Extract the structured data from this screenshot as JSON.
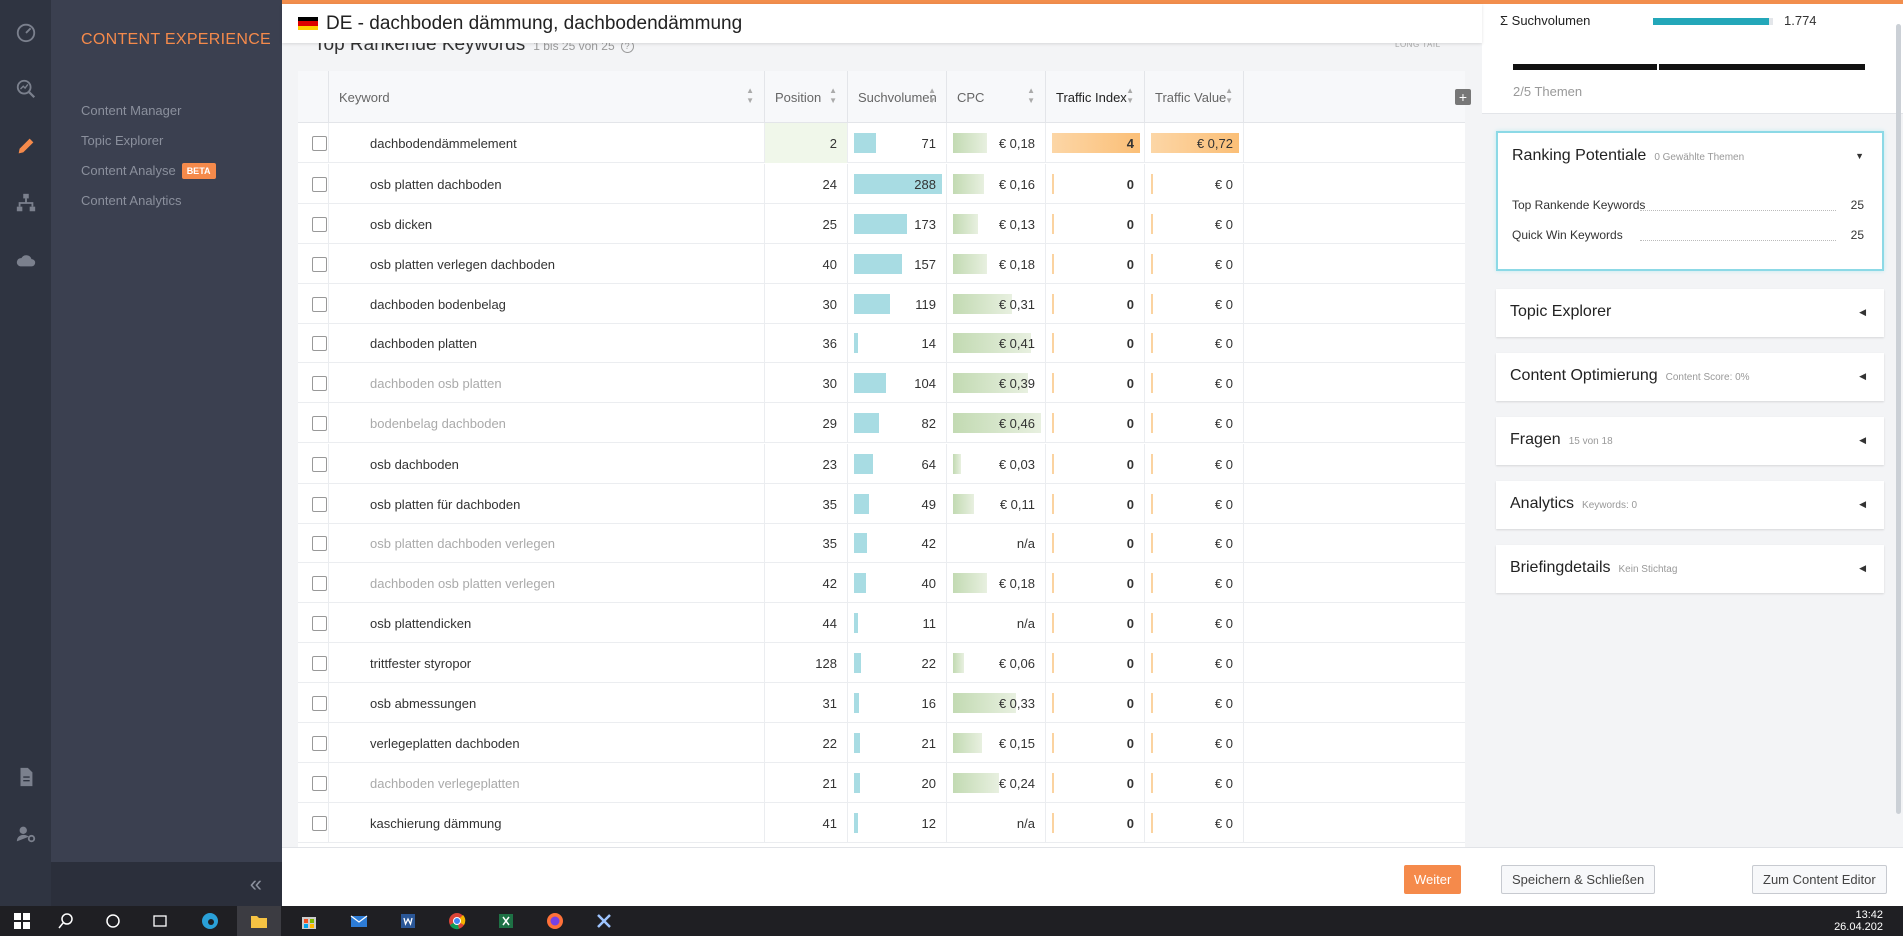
{
  "sidebar": {
    "brand": "CONTENT EXPERIENCE",
    "items": [
      {
        "label": "Content Manager"
      },
      {
        "label": "Topic Explorer"
      },
      {
        "label": "Content Analyse",
        "badge": "BETA"
      },
      {
        "label": "Content Analytics"
      }
    ],
    "collapse_icon": "«"
  },
  "header": {
    "flag": "de-flag-icon",
    "title": "DE - dachboden dämmung, dachbodendämmung"
  },
  "section": {
    "title": "Top Rankende Keywords",
    "count": "1 bis 25 von 25",
    "help": "?",
    "longtail": "LONG TAIL"
  },
  "table": {
    "columns": [
      {
        "label": "Keyword"
      },
      {
        "label": "Position"
      },
      {
        "label": "Suchvolumen"
      },
      {
        "label": "CPC"
      },
      {
        "label": "Traffic Index"
      },
      {
        "label": "Traffic Value"
      }
    ],
    "add_column": "+",
    "rows": [
      {
        "keyword": "dachbodendämmelement",
        "position": "2",
        "volume": "71",
        "volume_share": 0.25,
        "cpc": "€ 0,18",
        "cpc_share": 0.39,
        "ti": "4",
        "tv": "€ 0,72",
        "dim": false,
        "highlight": true
      },
      {
        "keyword": "osb platten dachboden",
        "position": "24",
        "volume": "288",
        "volume_share": 1.0,
        "cpc": "€ 0,16",
        "cpc_share": 0.35,
        "ti": "0",
        "tv": "€ 0",
        "dim": false,
        "highlight": false
      },
      {
        "keyword": "osb dicken",
        "position": "25",
        "volume": "173",
        "volume_share": 0.6,
        "cpc": "€ 0,13",
        "cpc_share": 0.28,
        "ti": "0",
        "tv": "€ 0",
        "dim": false,
        "highlight": false
      },
      {
        "keyword": "osb platten verlegen dachboden",
        "position": "40",
        "volume": "157",
        "volume_share": 0.55,
        "cpc": "€ 0,18",
        "cpc_share": 0.39,
        "ti": "0",
        "tv": "€ 0",
        "dim": false,
        "highlight": false
      },
      {
        "keyword": "dachboden bodenbelag",
        "position": "30",
        "volume": "119",
        "volume_share": 0.41,
        "cpc": "€ 0,31",
        "cpc_share": 0.67,
        "ti": "0",
        "tv": "€ 0",
        "dim": false,
        "highlight": false
      },
      {
        "keyword": "dachboden platten",
        "position": "36",
        "volume": "14",
        "volume_share": 0.05,
        "cpc": "€ 0,41",
        "cpc_share": 0.89,
        "ti": "0",
        "tv": "€ 0",
        "dim": false,
        "highlight": false
      },
      {
        "keyword": "dachboden osb platten",
        "position": "30",
        "volume": "104",
        "volume_share": 0.36,
        "cpc": "€ 0,39",
        "cpc_share": 0.85,
        "ti": "0",
        "tv": "€ 0",
        "dim": true,
        "highlight": false
      },
      {
        "keyword": "bodenbelag dachboden",
        "position": "29",
        "volume": "82",
        "volume_share": 0.28,
        "cpc": "€ 0,46",
        "cpc_share": 1.0,
        "ti": "0",
        "tv": "€ 0",
        "dim": true,
        "highlight": false
      },
      {
        "keyword": "osb dachboden",
        "position": "23",
        "volume": "64",
        "volume_share": 0.22,
        "cpc": "€ 0,03",
        "cpc_share": 0.07,
        "ti": "0",
        "tv": "€ 0",
        "dim": false,
        "highlight": false
      },
      {
        "keyword": "osb platten für dachboden",
        "position": "35",
        "volume": "49",
        "volume_share": 0.17,
        "cpc": "€ 0,11",
        "cpc_share": 0.24,
        "ti": "0",
        "tv": "€ 0",
        "dim": false,
        "highlight": false
      },
      {
        "keyword": "osb platten dachboden verlegen",
        "position": "35",
        "volume": "42",
        "volume_share": 0.15,
        "cpc": "n/a",
        "cpc_share": 0,
        "ti": "0",
        "tv": "€ 0",
        "dim": true,
        "highlight": false
      },
      {
        "keyword": "dachboden osb platten verlegen",
        "position": "42",
        "volume": "40",
        "volume_share": 0.14,
        "cpc": "€ 0,18",
        "cpc_share": 0.39,
        "ti": "0",
        "tv": "€ 0",
        "dim": true,
        "highlight": false
      },
      {
        "keyword": "osb plattendicken",
        "position": "44",
        "volume": "11",
        "volume_share": 0.04,
        "cpc": "n/a",
        "cpc_share": 0,
        "ti": "0",
        "tv": "€ 0",
        "dim": false,
        "highlight": false
      },
      {
        "keyword": "trittfester styropor",
        "position": "128",
        "volume": "22",
        "volume_share": 0.08,
        "cpc": "€ 0,06",
        "cpc_share": 0.13,
        "ti": "0",
        "tv": "€ 0",
        "dim": false,
        "highlight": false
      },
      {
        "keyword": "osb abmessungen",
        "position": "31",
        "volume": "16",
        "volume_share": 0.06,
        "cpc": "€ 0,33",
        "cpc_share": 0.72,
        "ti": "0",
        "tv": "€ 0",
        "dim": false,
        "highlight": false
      },
      {
        "keyword": "verlegeplatten dachboden",
        "position": "22",
        "volume": "21",
        "volume_share": 0.07,
        "cpc": "€ 0,15",
        "cpc_share": 0.33,
        "ti": "0",
        "tv": "€ 0",
        "dim": false,
        "highlight": false
      },
      {
        "keyword": "dachboden verlegeplatten",
        "position": "21",
        "volume": "20",
        "volume_share": 0.07,
        "cpc": "€ 0,24",
        "cpc_share": 0.52,
        "ti": "0",
        "tv": "€ 0",
        "dim": true,
        "highlight": false
      },
      {
        "keyword": "kaschierung dämmung",
        "position": "41",
        "volume": "12",
        "volume_share": 0.04,
        "cpc": "n/a",
        "cpc_share": 0,
        "ti": "0",
        "tv": "€ 0",
        "dim": false,
        "highlight": false
      }
    ]
  },
  "right": {
    "suchvolumen_label": "Σ Suchvolumen",
    "suchvolumen_value": "1.774",
    "suchvolumen_fill": 0.97,
    "themen": "2/5 Themen",
    "cards": [
      {
        "title": "Ranking Potentiale",
        "sub": "0 Gewählte Themen",
        "caret": "▼"
      },
      {
        "title": "Topic Explorer",
        "sub": "",
        "caret": "◀"
      },
      {
        "title": "Content Optimierung",
        "sub": "Content Score: 0%",
        "caret": "◀"
      },
      {
        "title": "Fragen",
        "sub": "15 von 18",
        "caret": "◀"
      },
      {
        "title": "Analytics",
        "sub": "Keywords: 0",
        "caret": "◀"
      },
      {
        "title": "Briefingdetails",
        "sub": "Kein Stichtag",
        "caret": "◀"
      }
    ],
    "ranking_lines": [
      {
        "label": "Top Rankende Keywords",
        "value": "25"
      },
      {
        "label": "Quick Win Keywords",
        "value": "25"
      }
    ]
  },
  "footer": {
    "weiter": "Weiter",
    "save_close": "Speichern & Schließen",
    "to_editor": "Zum Content Editor"
  },
  "taskbar": {
    "time": "13:42",
    "date": "26.04.202"
  },
  "colors": {
    "accent": "#f58a4b",
    "volume_bar": "#a8dce3",
    "cpc_bar": "#c2dab2",
    "traffic_bar": "#fbbf77",
    "suchvolumen_bar": "#23a7b9"
  }
}
